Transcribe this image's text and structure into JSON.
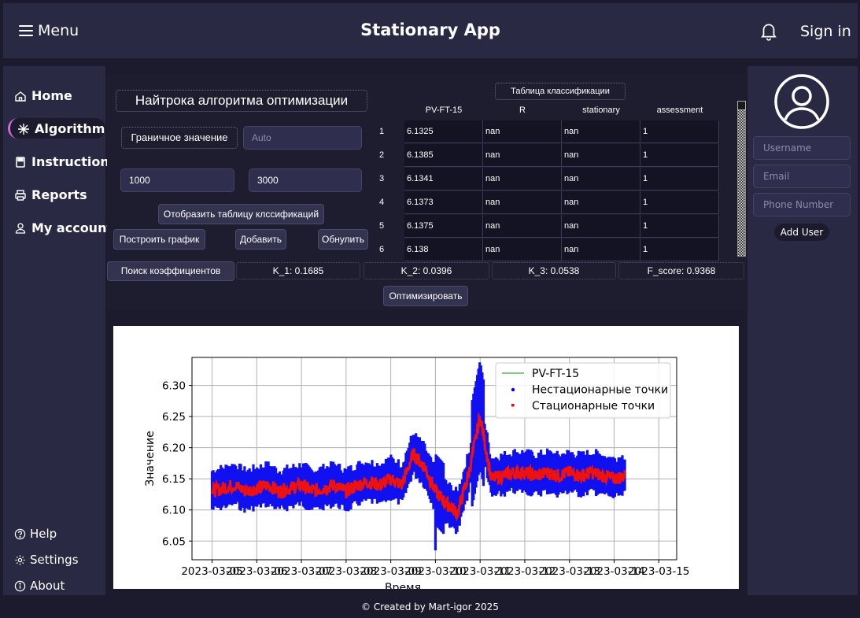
{
  "header": {
    "menu_label": "Menu",
    "title": "Stationary App",
    "signin_label": "Sign in",
    "bell_icon": "bell-icon"
  },
  "sidebar": {
    "items": [
      {
        "label": "Home",
        "icon": "home-icon"
      },
      {
        "label": "Algorithm",
        "icon": "snowflake-icon",
        "active": true
      },
      {
        "label": "Instruction",
        "icon": "book-icon"
      },
      {
        "label": "Reports",
        "icon": "printer-icon"
      },
      {
        "label": "My account",
        "icon": "user-icon"
      }
    ],
    "footer_items": [
      {
        "label": "Help",
        "icon": "help-icon"
      },
      {
        "label": "Settings",
        "icon": "gear-icon"
      },
      {
        "label": "About",
        "icon": "info-icon"
      }
    ],
    "accent": "#d26bd8"
  },
  "main": {
    "title": "Найтрока алгоритма оптимизации",
    "threshold_label": "Граничное значение",
    "threshold_placeholder": "Auto",
    "range_from": "1000",
    "range_to": "3000",
    "show_table_button": "Отобразить таблицу клссификаций",
    "plot_button": "Построить график",
    "add_button": "Добавить",
    "reset_button": "Обнулить",
    "search_coeffs_button": "Поиск коэффициентов",
    "k1": "K_1: 0.1685",
    "k2": "K_2: 0.0396",
    "k3": "K_3: 0.0538",
    "fscore": "F_score: 0.9368",
    "optimize_button": "Оптимизировать"
  },
  "table": {
    "title": "Таблица классификации",
    "columns": [
      "PV-FT-15",
      "R",
      "stationary",
      "assessment"
    ],
    "rows": [
      {
        "n": "1",
        "cells": [
          "6.1325",
          "nan",
          "nan",
          "1"
        ]
      },
      {
        "n": "2",
        "cells": [
          "6.1385",
          "nan",
          "nan",
          "1"
        ]
      },
      {
        "n": "3",
        "cells": [
          "6.1341",
          "nan",
          "nan",
          "1"
        ]
      },
      {
        "n": "4",
        "cells": [
          "6.1373",
          "nan",
          "nan",
          "1"
        ]
      },
      {
        "n": "5",
        "cells": [
          "6.1375",
          "nan",
          "nan",
          "1"
        ]
      },
      {
        "n": "6",
        "cells": [
          "6.138",
          "nan",
          "nan",
          "1"
        ]
      }
    ]
  },
  "right": {
    "username_placeholder": "Username",
    "email_placeholder": "Email",
    "phone_placeholder": "Phone Number",
    "add_user_button": "Add User",
    "avatar_icon": "avatar-icon"
  },
  "footer": {
    "text": "© Created by Mart-igor 2025"
  },
  "chart_data": {
    "type": "line",
    "xlabel": "Время",
    "ylabel": "Значение",
    "x_tick_labels": [
      "2023-03-05",
      "2023-03-06",
      "2023-03-07",
      "2023-03-08",
      "2023-03-09",
      "2023-03-10",
      "2023-03-11",
      "2023-03-12",
      "2023-03-13",
      "2023-03-14",
      "2023-03-15"
    ],
    "y_tick_labels": [
      "6.05",
      "6.10",
      "6.15",
      "6.20",
      "6.25",
      "6.30"
    ],
    "ylim": [
      6.02,
      6.345
    ],
    "grid": true,
    "legend_position": "top-right",
    "series": [
      {
        "name": "PV-FT-15",
        "kind": "line",
        "color": "#5cb85c"
      },
      {
        "name": "Нестационарные точки",
        "kind": "scatter",
        "color": "#0000ff"
      },
      {
        "name": "Стационарные точки",
        "kind": "scatter",
        "color": "#ff0000"
      }
    ],
    "x_days": [
      5.0,
      5.25,
      5.5,
      5.75,
      6.0,
      6.25,
      6.5,
      6.75,
      7.0,
      7.25,
      7.5,
      7.75,
      8.0,
      8.25,
      8.5,
      8.75,
      9.0,
      9.25,
      9.5,
      9.75,
      10.0,
      10.25,
      10.5,
      10.75,
      11.0,
      11.25,
      11.5,
      11.75,
      12.0,
      12.25,
      12.5,
      12.75,
      13.0,
      13.25,
      13.5,
      13.75,
      14.0,
      14.25
    ],
    "stationary_values": [
      6.13,
      6.135,
      6.14,
      6.13,
      6.135,
      6.14,
      6.13,
      6.135,
      6.14,
      6.13,
      6.135,
      6.14,
      6.13,
      6.14,
      6.145,
      6.14,
      6.15,
      6.14,
      6.19,
      6.17,
      6.13,
      6.11,
      6.095,
      6.16,
      6.25,
      6.15,
      6.155,
      6.16,
      6.16,
      6.155,
      6.16,
      6.155,
      6.16,
      6.155,
      6.16,
      6.155,
      6.15,
      6.155
    ],
    "spike_peak": 6.33,
    "dip_min": 6.035
  }
}
